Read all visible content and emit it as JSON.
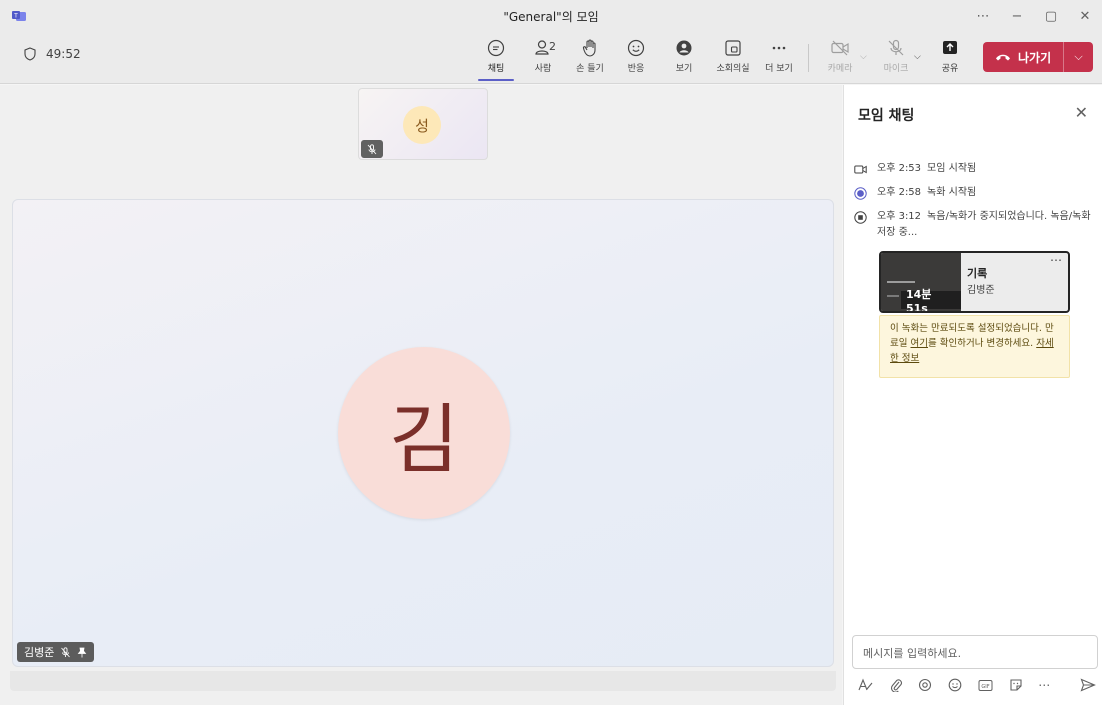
{
  "window": {
    "title": "\"General\"의 모임",
    "controls": [
      "⋯",
      "−",
      "▢",
      "✕"
    ]
  },
  "toolbar": {
    "timer": "49:52",
    "buttons": {
      "chat": "채팅",
      "people": "사람",
      "people_count": "2",
      "raise_hand": "손 들기",
      "react": "반응",
      "view": "보기",
      "rooms": "소회의실",
      "more": "더 보기",
      "camera": "카메라",
      "mic": "마이크",
      "share": "공유"
    },
    "leave_label": "나가기",
    "colors": {
      "accent": "#5b5fc7",
      "leave": "#c4314b"
    }
  },
  "stage": {
    "thumbnail_initial": "성",
    "main_initial": "김",
    "main_name": "김병준"
  },
  "chat": {
    "title": "모임 채팅",
    "events": [
      {
        "icon": "camera-icon",
        "time": "오후 2:53",
        "text": "모임 시작됨"
      },
      {
        "icon": "record-icon",
        "time": "오후 2:58",
        "text": "녹화 시작됨"
      },
      {
        "icon": "stop-record-icon",
        "time": "오후 3:12",
        "text": "녹음/녹화가 중지되었습니다. 녹음/녹화 저장 중..."
      }
    ],
    "recording": {
      "title": "기록",
      "owner": "김병준",
      "duration": "14분 51s",
      "more": "⋯"
    },
    "notice": {
      "line1": "이 녹화는 만료되도록 설정되었습니다. 만료일 ",
      "link1": "여기",
      "line2": "를 확인하거나 변경하세요. ",
      "link2": "자세한 정보"
    },
    "compose_placeholder": "메시지를 입력하세요.",
    "more": "⋯"
  }
}
